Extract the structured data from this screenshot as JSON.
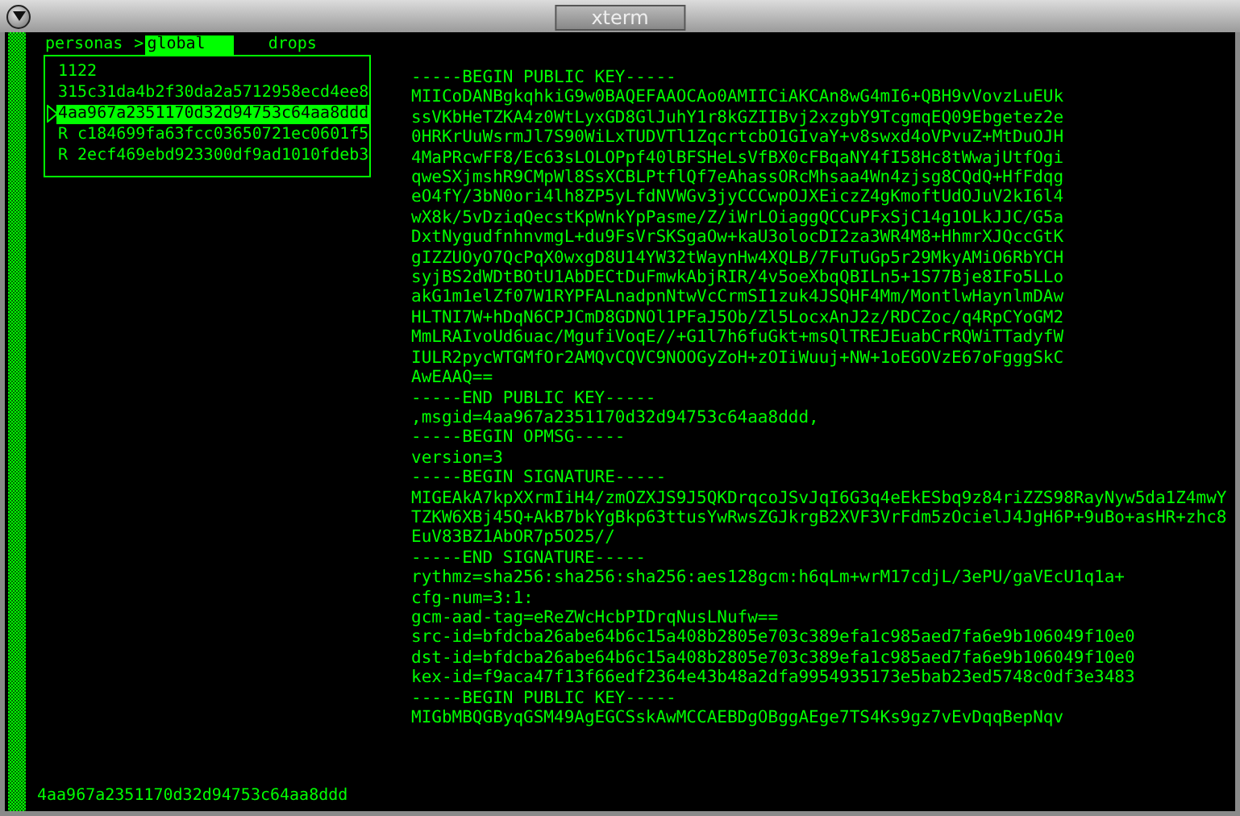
{
  "window": {
    "title": "xterm"
  },
  "tabs": {
    "marker": ">",
    "items": [
      {
        "label": "personas",
        "selected": false
      },
      {
        "label": "global",
        "selected": true
      },
      {
        "label": "drops",
        "selected": false
      }
    ]
  },
  "list": {
    "items": [
      {
        "label": "1122",
        "selected": false
      },
      {
        "label": "315c31da4b2f30da2a5712958ecd4ee8",
        "selected": false
      },
      {
        "label": "4aa967a2351170d32d94753c64aa8ddd",
        "selected": true
      },
      {
        "label": "R c184699fa63fcc03650721ec0601f5",
        "selected": false
      },
      {
        "label": "R 2ecf469ebd923300df9ad1010fdeb3",
        "selected": false
      }
    ]
  },
  "message": {
    "lines": [
      "-----BEGIN PUBLIC KEY-----",
      "MIICoDANBgkqhkiG9w0BAQEFAAOCAo0AMIICiAKCAn8wG4mI6+QBH9vVovzLuEUk",
      "ssVKbHeTZKA4z0WtLyxGD8GlJuhY1r8kGZIIBvj2xzgbY9TcgmqEQ09Ebgetez2e",
      "0HRKrUuWsrmJl7S90WiLxTUDVTl1ZqcrtcbO1GIvaY+v8swxd4oVPvuZ+MtDuOJH",
      "4MaPRcwFF8/Ec63sLOLOPpf40lBFSHeLsVfBX0cFBqaNY4fI58Hc8tWwajUtfOgi",
      "qweSXjmshR9CMpWl8SsXCBLPtflQf7eAhassORcMhsaa4Wn4zjsg8CQdQ+HfFdqg",
      "eO4fY/3bN0ori4lh8ZP5yLfdNVWGv3jyCCCwpOJXEiczZ4gKmoftUdOJuV2kI6l4",
      "wX8k/5vDziqQecstKpWnkYpPasme/Z/iWrLOiaggQCCuPFxSjC14g1OLkJJC/G5a",
      "DxtNygudfnhnvmgL+du9FsVrSKSgaOw+kaU3olocDI2za3WR4M8+HhmrXJQccGtK",
      "gIZZUOyO7QcPqX0wxgD8U14YW32tWaynHw4XQLB/7FuTuGp5r29MkyAMiO6RbYCH",
      "syjBS2dWDtBOtU1AbDECtDuFmwkAbjRIR/4v5oeXbqQBILn5+1S77Bje8IFo5LLo",
      "akG1m1elZf07W1RYPFALnadpnNtwVcCrmSI1zuk4JSQHF4Mm/MontlwHaynlmDAw",
      "HLTNI7W+hDqN6CPJCmD8GDNOl1PFaJ5Ob/Zl5LocxAnJ2z/RDCZoc/q4RpCYoGM2",
      "MmLRAIvoUd6uac/MgufiVoqE//+G1l7h6fuGkt+msQlTREJEuabCrRQWiTTadyfW",
      "IULR2pycWTGMfOr2AMQvCQVC9NOOGyZoH+zOIiWuuj+NW+1oEGOVzE67oFgggSkC",
      "AwEAAQ==",
      "-----END PUBLIC KEY-----",
      ",msgid=4aa967a2351170d32d94753c64aa8ddd,",
      "-----BEGIN OPMSG-----",
      "version=3",
      "-----BEGIN SIGNATURE-----",
      "MIGEAkA7kpXXrmIiH4/zmOZXJS9J5QKDrqcoJSvJqI6G3q4eEkESbq9z84riZZS98RayNyw5da1Z4mwY",
      "TZKW6XBj45Q+AkB7bkYgBkp63ttusYwRwsZGJkrgB2XVF3VrFdm5zOcielJ4JgH6P+9uBo+asHR+zhc8",
      "EuV83BZ1AbOR7p5O25//",
      "-----END SIGNATURE-----",
      "rythmz=sha256:sha256:sha256:aes128gcm:h6qLm+wrM17cdjL/3ePU/gaVEcU1q1a+",
      "cfg-num=3:1:",
      "gcm-aad-tag=eReZWcHcbPIDrqNusLNufw==",
      "src-id=bfdcba26abe64b6c15a408b2805e703c389efa1c985aed7fa6e9b106049f10e0",
      "dst-id=bfdcba26abe64b6c15a408b2805e703c389efa1c985aed7fa6e9b106049f10e0",
      "kex-id=f9aca47f13f66edf2364e43b48a2dfa9954935173e5bab23ed5748c0df3e3483",
      "-----BEGIN PUBLIC KEY-----",
      "MIGbMBQGByqGSM49AgEGCSskAwMCCAEBDgOBggAEge7TS4Ks9gz7vEvDqqBepNqv"
    ]
  },
  "status_line": "4aa967a2351170d32d94753c64aa8ddd"
}
